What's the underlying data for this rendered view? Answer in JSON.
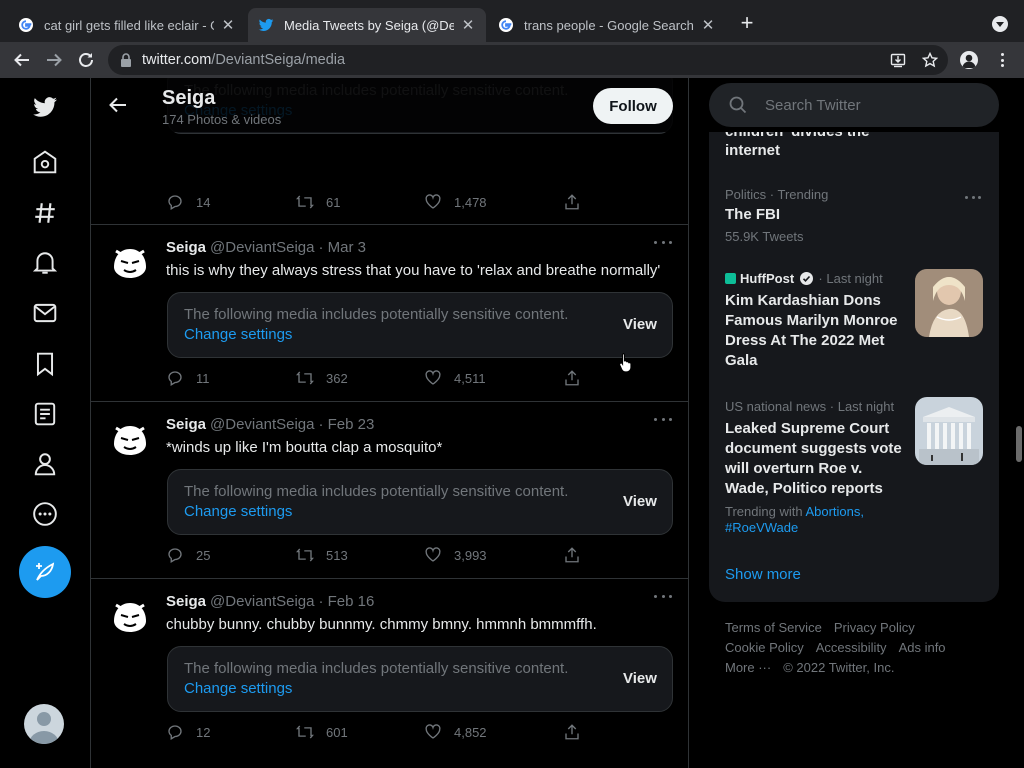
{
  "browser": {
    "tabs": [
      {
        "title": "cat girl gets filled like eclair - G",
        "favicon": "google-icon"
      },
      {
        "title": "Media Tweets by Seiga (@Devi",
        "favicon": "twitter-icon"
      },
      {
        "title": "trans people - Google Search",
        "favicon": "google-icon"
      }
    ],
    "url_host": "twitter.com",
    "url_path": "/DeviantSeiga/media"
  },
  "profile": {
    "name": "Seiga",
    "count": "174 Photos & videos",
    "follow_label": "Follow"
  },
  "sensitive": {
    "message": "The following media includes potentially sensitive content.",
    "change": "Change settings",
    "view": "View"
  },
  "tweets": [
    {
      "name": "",
      "handle": "",
      "date": "",
      "text": "",
      "replies": "14",
      "retweets": "61",
      "likes": "1,478"
    },
    {
      "name": "Seiga",
      "handle": "@DeviantSeiga",
      "date": "· Mar 3",
      "text": "this is why they always stress that you have to 'relax and breathe normally'",
      "replies": "11",
      "retweets": "362",
      "likes": "4,511"
    },
    {
      "name": "Seiga",
      "handle": "@DeviantSeiga",
      "date": "· Feb 23",
      "text": "*winds up like I'm boutta clap a mosquito*",
      "replies": "25",
      "retweets": "513",
      "likes": "3,993"
    },
    {
      "name": "Seiga",
      "handle": "@DeviantSeiga",
      "date": "· Feb 16",
      "text": "chubby bunny. chubby bunnmy. chmmy bmny. hmmnh bmmmffh.",
      "replies": "12",
      "retweets": "601",
      "likes": "4,852"
    }
  ],
  "search": {
    "placeholder": "Search Twitter"
  },
  "trends": {
    "partial_title_1": "children' divides the",
    "partial_title_2": "internet",
    "t1_meta": "Politics · Trending",
    "t1_title": "The FBI",
    "t1_count": "55.9K Tweets",
    "t2_publisher": "HuffPost",
    "t2_time": "· Last night",
    "t2_title": "Kim Kardashian Dons Famous Marilyn Monroe Dress At The 2022 Met Gala",
    "t3_meta": "US national news · Last night",
    "t3_title": "Leaked Supreme Court document suggests vote will overturn Roe v. Wade, Politico reports",
    "t3_trending_with": "Trending with",
    "t3_tag1": "Abortions,",
    "t3_tag2": "#RoeVWade",
    "show_more": "Show more"
  },
  "footer": {
    "terms": "Terms of Service",
    "privacy": "Privacy Policy",
    "cookie": "Cookie Policy",
    "accessibility": "Accessibility",
    "ads": "Ads info",
    "more": "More ···",
    "copyright": "© 2022 Twitter, Inc."
  },
  "colors": {
    "accent": "#1d9bf0",
    "background": "#000000",
    "card": "#16181c",
    "border": "#2f3336"
  }
}
